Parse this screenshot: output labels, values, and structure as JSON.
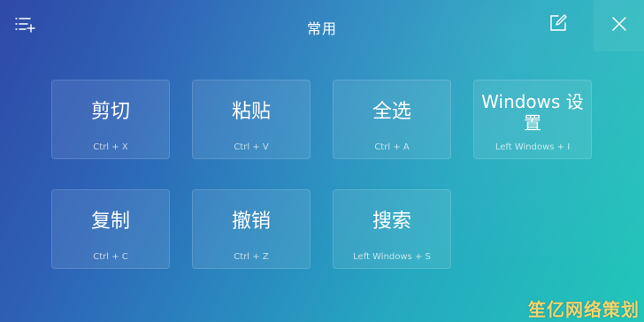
{
  "header": {
    "title": "常用",
    "menu_icon": "list-add-icon",
    "edit_icon": "edit-icon",
    "close_icon": "close-icon"
  },
  "tiles": [
    {
      "label": "剪切",
      "shortcut": "Ctrl + X"
    },
    {
      "label": "粘贴",
      "shortcut": "Ctrl + V"
    },
    {
      "label": "全选",
      "shortcut": "Ctrl + A"
    },
    {
      "label": "Windows 设置",
      "shortcut": "Left Windows + I"
    },
    {
      "label": "复制",
      "shortcut": "Ctrl + C"
    },
    {
      "label": "撤销",
      "shortcut": "Ctrl + Z"
    },
    {
      "label": "搜索",
      "shortcut": "Left Windows + S"
    }
  ],
  "watermark": "笙亿网络策划",
  "colors": {
    "gradient_start": "#2f49a8",
    "gradient_end": "#22c7b9",
    "watermark": "#f4d36a"
  }
}
